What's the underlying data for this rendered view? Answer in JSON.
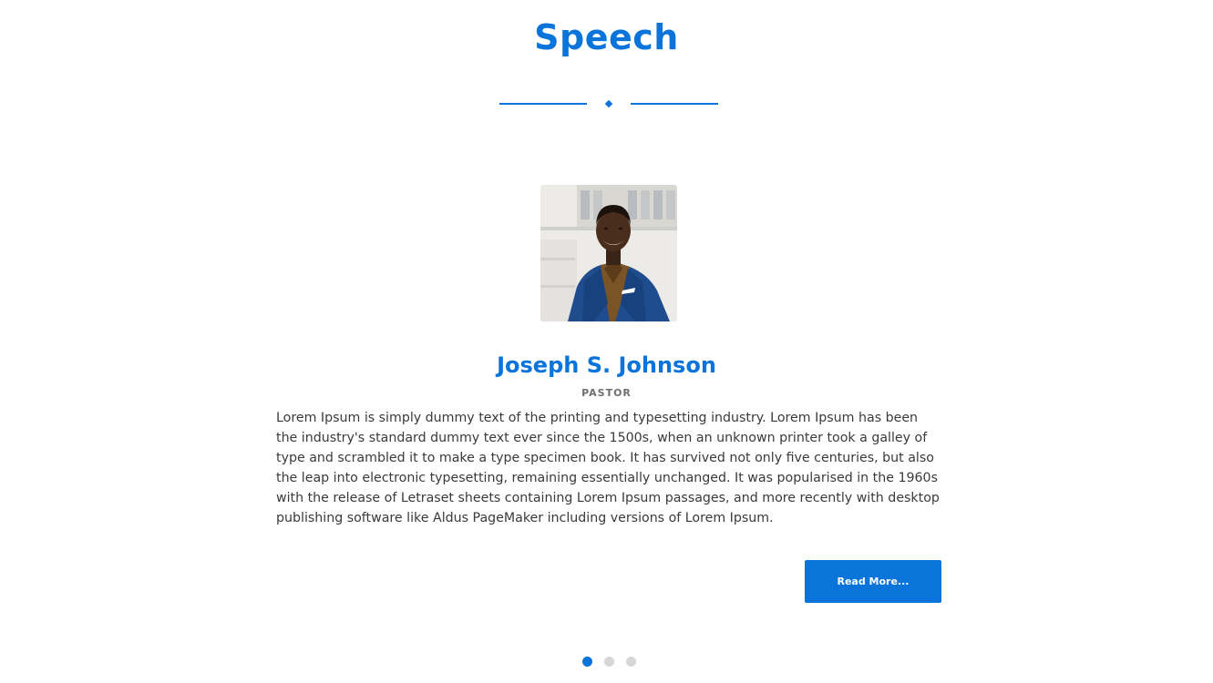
{
  "section": {
    "title": "Speech"
  },
  "speaker": {
    "name": "Joseph S. Johnson",
    "role": "PASTOR",
    "text": "Lorem Ipsum is simply dummy text of the printing and typesetting industry. Lorem Ipsum has been the industry's standard dummy text ever since the 1500s, when an unknown printer took a galley of type and scrambled it to make a type specimen book. It has survived not only five centuries, but also the leap into electronic typesetting, remaining essentially unchanged. It was popularised in the 1960s with the release of Letraset sheets containing Lorem Ipsum passages, and more recently with desktop publishing software like Aldus PageMaker including versions of Lorem Ipsum.",
    "button_label": "Read More..."
  },
  "carousel": {
    "slide_count": 3,
    "active_index": 0
  },
  "colors": {
    "accent": "#0a74da",
    "dot_inactive": "#d6d6d6"
  }
}
